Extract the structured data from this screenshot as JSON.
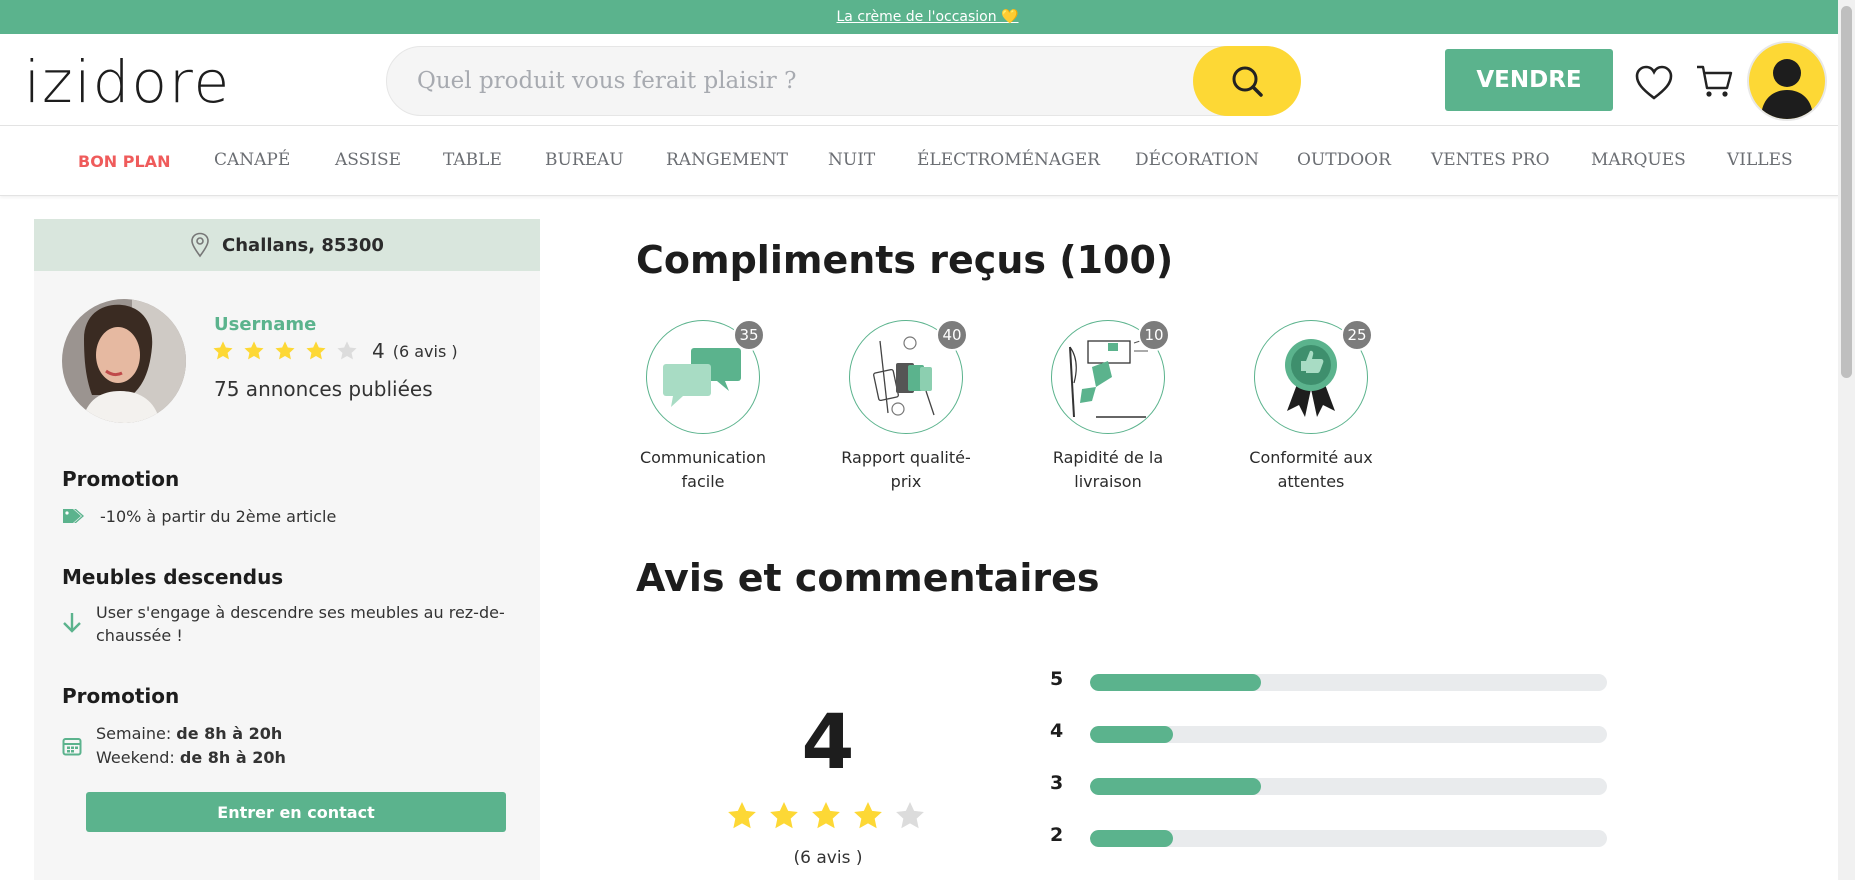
{
  "topbar": {
    "text": "La crème de l'occasion 💛"
  },
  "header": {
    "logo": "izidore",
    "search_placeholder": "Quel produit vous ferait plaisir ?",
    "sell_label": "VENDRE"
  },
  "nav": {
    "items": [
      "BON PLAN",
      "CANAPÉ",
      "ASSISE",
      "TABLE",
      "BUREAU",
      "RANGEMENT",
      "NUIT",
      "ÉLECTROMÉNAGER",
      "DÉCORATION",
      "OUTDOOR",
      "VENTES PRO",
      "MARQUES",
      "VILLES"
    ]
  },
  "sidebar": {
    "location": "Challans, 85300",
    "username": "Username",
    "rating": 4,
    "rating_value": "4",
    "rating_count": "(6 avis )",
    "published": "75 annonces publiées",
    "promotion1": {
      "title": "Promotion",
      "text": "-10% à partir du 2ème article"
    },
    "meubles": {
      "title": "Meubles descendus",
      "line1": "User s'engage à descendre ses meubles au rez-de-",
      "line2": "chaussée !"
    },
    "promotion2": {
      "title": "Promotion",
      "week_label": "Semaine: ",
      "week_value": "de 8h à 20h",
      "weekend_label": "Weekend: ",
      "weekend_value": "de 8h à 20h"
    },
    "contact_label": "Entrer en contact"
  },
  "compliments": {
    "title": "Compliments reçus (100)",
    "badges": [
      {
        "count": "35",
        "line1": "Communication",
        "line2": "facile",
        "icon": "chat-bubbles-icon"
      },
      {
        "count": "40",
        "line1": "Rapport qualité-",
        "line2": "prix",
        "icon": "price-quality-icon"
      },
      {
        "count": "10",
        "line1": "Rapidité de la",
        "line2": "livraison",
        "icon": "fast-delivery-icon"
      },
      {
        "count": "25",
        "line1": "Conformité aux",
        "line2": "attentes",
        "icon": "award-ribbon-icon"
      }
    ]
  },
  "reviews": {
    "title": "Avis et commentaires",
    "average": "4",
    "average_stars": 4,
    "count": "(6 avis )",
    "distribution": [
      {
        "label": "5",
        "fraction": 0.33
      },
      {
        "label": "4",
        "fraction": 0.16
      },
      {
        "label": "3",
        "fraction": 0.33
      },
      {
        "label": "2",
        "fraction": 0.16
      }
    ]
  },
  "colors": {
    "brand": "#5bb38d",
    "accent": "#fdd835",
    "promo": "#ef5b5b"
  }
}
